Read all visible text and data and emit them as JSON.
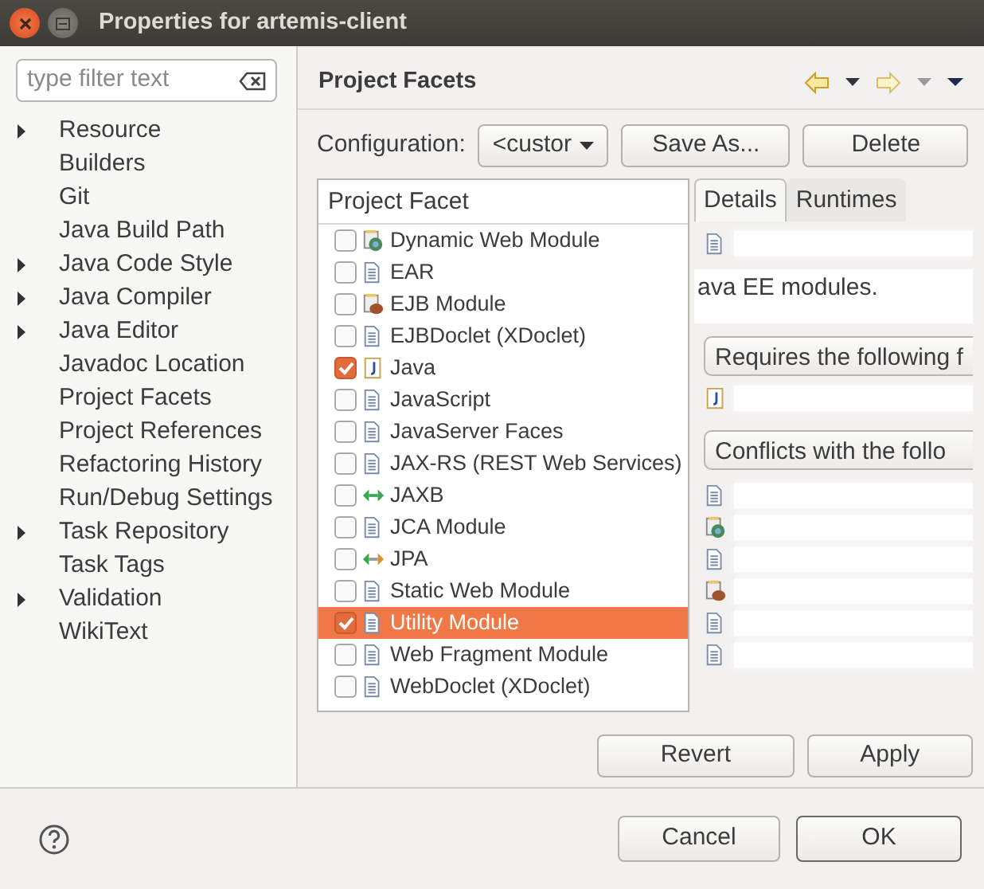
{
  "window": {
    "title": "Properties for artemis-client"
  },
  "filter": {
    "placeholder": "type filter text"
  },
  "tree": [
    {
      "label": "Resource",
      "expandable": true
    },
    {
      "label": "Builders",
      "expandable": false
    },
    {
      "label": "Git",
      "expandable": false
    },
    {
      "label": "Java Build Path",
      "expandable": false
    },
    {
      "label": "Java Code Style",
      "expandable": true
    },
    {
      "label": "Java Compiler",
      "expandable": true
    },
    {
      "label": "Java Editor",
      "expandable": true
    },
    {
      "label": "Javadoc Location",
      "expandable": false
    },
    {
      "label": "Project Facets",
      "expandable": false
    },
    {
      "label": "Project References",
      "expandable": false
    },
    {
      "label": "Refactoring History",
      "expandable": false
    },
    {
      "label": "Run/Debug Settings",
      "expandable": false
    },
    {
      "label": "Task Repository",
      "expandable": true
    },
    {
      "label": "Task Tags",
      "expandable": false
    },
    {
      "label": "Validation",
      "expandable": true
    },
    {
      "label": "WikiText",
      "expandable": false
    }
  ],
  "page_title": "Project Facets",
  "configuration": {
    "label": "Configuration:",
    "value": "<custor",
    "buttons": [
      {
        "label": "Save As..."
      },
      {
        "label": "Delete"
      }
    ]
  },
  "facet_table": {
    "column": "Project Facet",
    "rows": [
      {
        "label": "Dynamic Web Module",
        "checked": false,
        "selected": false,
        "kind": "web"
      },
      {
        "label": "EAR",
        "checked": false,
        "selected": false,
        "kind": "file"
      },
      {
        "label": "EJB Module",
        "checked": false,
        "selected": false,
        "kind": "ejb"
      },
      {
        "label": "EJBDoclet (XDoclet)",
        "checked": false,
        "selected": false,
        "kind": "file"
      },
      {
        "label": "Java",
        "checked": true,
        "selected": false,
        "kind": "java"
      },
      {
        "label": "JavaScript",
        "checked": false,
        "selected": false,
        "kind": "file"
      },
      {
        "label": "JavaServer Faces",
        "checked": false,
        "selected": false,
        "kind": "file"
      },
      {
        "label": "JAX-RS (REST Web Services)",
        "checked": false,
        "selected": false,
        "kind": "file"
      },
      {
        "label": "JAXB",
        "checked": false,
        "selected": false,
        "kind": "jaxb"
      },
      {
        "label": "JCA Module",
        "checked": false,
        "selected": false,
        "kind": "file"
      },
      {
        "label": "JPA",
        "checked": false,
        "selected": false,
        "kind": "jpa"
      },
      {
        "label": "Static Web Module",
        "checked": false,
        "selected": false,
        "kind": "file"
      },
      {
        "label": "Utility Module",
        "checked": true,
        "selected": true,
        "kind": "file"
      },
      {
        "label": "Web Fragment Module",
        "checked": false,
        "selected": false,
        "kind": "file"
      },
      {
        "label": "WebDoclet (XDoclet)",
        "checked": false,
        "selected": false,
        "kind": "file"
      }
    ]
  },
  "detail_tabs": [
    {
      "label": "Details",
      "selected": true
    },
    {
      "label": "Runtimes",
      "selected": false
    }
  ],
  "details": {
    "header_rows": [
      {
        "kind": "file"
      }
    ],
    "description": "ava EE modules.",
    "requires_label": "Requires the following f",
    "requires": [
      {
        "kind": "java"
      }
    ],
    "conflicts_label": "Conflicts with the follo",
    "conflicts": [
      {
        "kind": "file"
      },
      {
        "kind": "web"
      },
      {
        "kind": "file"
      },
      {
        "kind": "ejb"
      },
      {
        "kind": "file"
      },
      {
        "kind": "file"
      }
    ]
  },
  "actions": [
    {
      "label": "Revert"
    },
    {
      "label": "Apply"
    }
  ],
  "footer": [
    {
      "label": "Cancel"
    },
    {
      "label": "OK"
    }
  ]
}
